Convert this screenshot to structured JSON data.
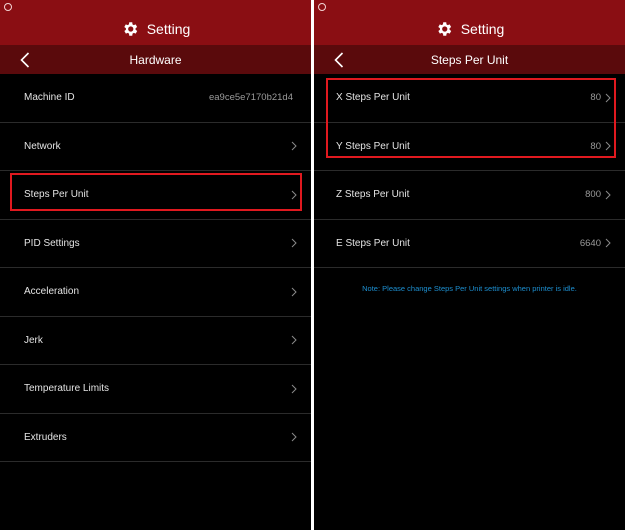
{
  "colors": {
    "header_bg": "#8a0e13",
    "nav_bg": "#5a0a0c",
    "panel_bg": "#000000",
    "highlight": "#e0191f",
    "note": "#1d8fd0"
  },
  "left": {
    "header_title": "Setting",
    "nav_title": "Hardware",
    "items": [
      {
        "label": "Machine ID",
        "value": "ea9ce5e7170b21d4"
      },
      {
        "label": "Network"
      },
      {
        "label": "Steps Per Unit"
      },
      {
        "label": "PID Settings"
      },
      {
        "label": "Acceleration"
      },
      {
        "label": "Jerk"
      },
      {
        "label": "Temperature Limits"
      },
      {
        "label": "Extruders"
      }
    ]
  },
  "right": {
    "header_title": "Setting",
    "nav_title": "Steps Per Unit",
    "items": [
      {
        "label": "X Steps Per Unit",
        "value": "80"
      },
      {
        "label": "Y Steps Per Unit",
        "value": "80"
      },
      {
        "label": "Z Steps Per Unit",
        "value": "800"
      },
      {
        "label": "E Steps Per Unit",
        "value": "6640"
      }
    ],
    "note": "Note: Please change Steps Per Unit settings when printer is idle."
  },
  "icons": {
    "gear": "gear-icon",
    "back": "chevron-left-icon",
    "row_arrow": "chevron-right-icon",
    "app_logo": "app-logo-icon"
  }
}
